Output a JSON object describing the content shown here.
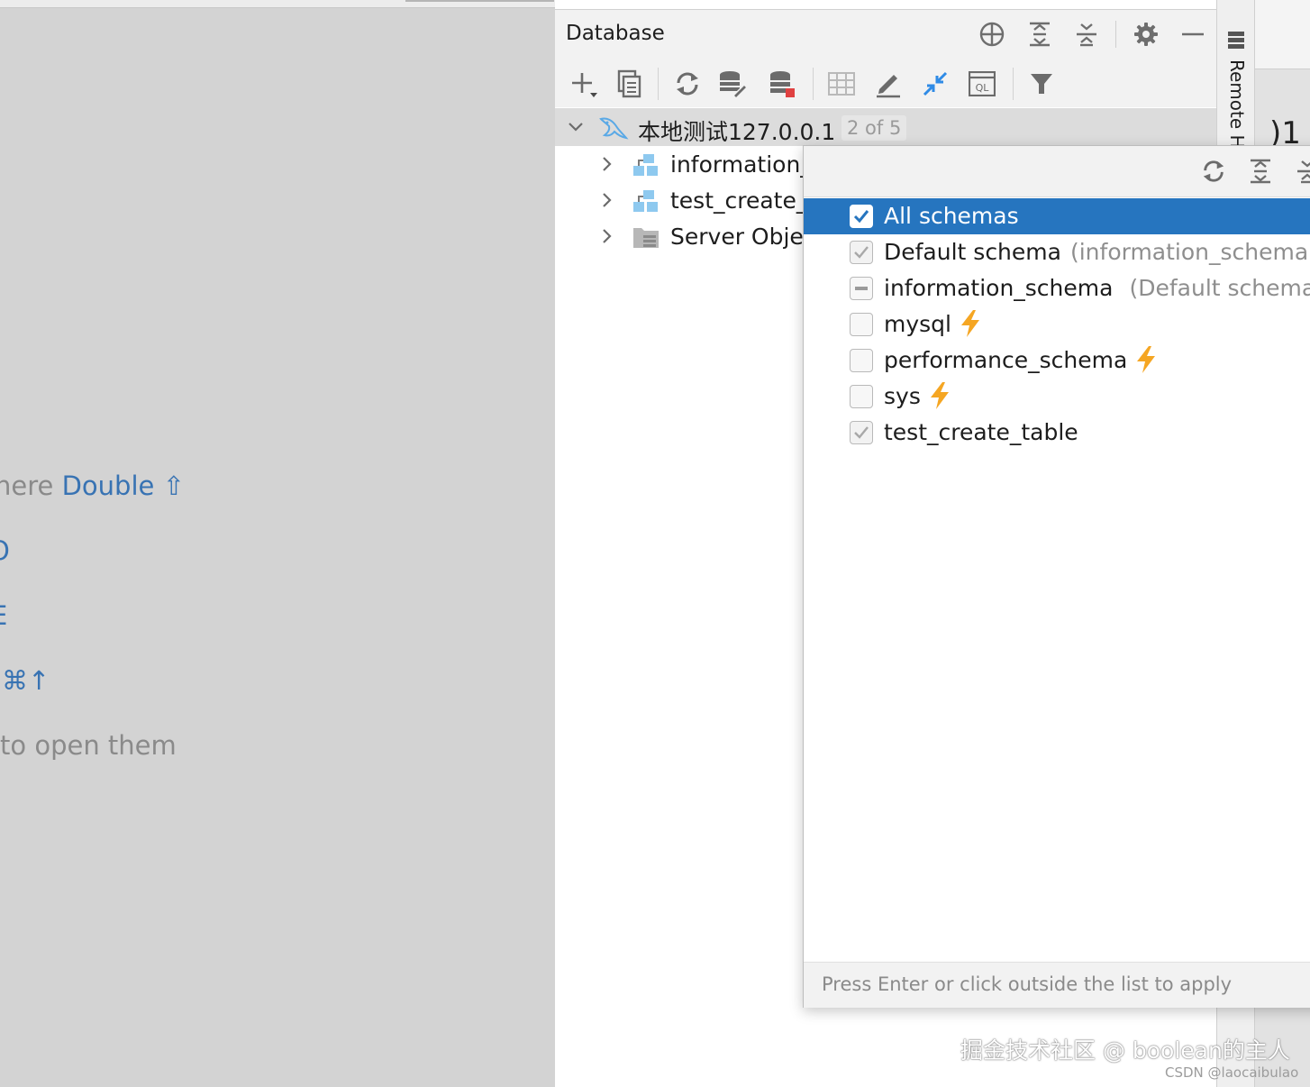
{
  "left_hints": {
    "search_prefix": "here",
    "search_action": "Double",
    "search_key": "⇧",
    "line2": "O",
    "line3": "E",
    "line4": "⌘↑",
    "open_hint": "to open them"
  },
  "database_panel": {
    "title": "Database",
    "header_icons": [
      "crosshair-icon",
      "expand-all-icon",
      "collapse-all-icon",
      "gear-icon",
      "minimize-icon"
    ],
    "toolbar_icons": [
      "add-icon",
      "copy-icon",
      "refresh-icon",
      "schema-tools-icon",
      "datasource-props-icon",
      "table-view-icon",
      "edit-icon",
      "jump-to-icon",
      "query-console-icon",
      "filter-icon"
    ],
    "query_console_label": "QL",
    "tree": {
      "root": {
        "label": "本地测试127.0.0.1",
        "badge": "2 of 5"
      },
      "children": [
        {
          "label": "information_"
        },
        {
          "label": "test_create_"
        },
        {
          "label": "Server Obje"
        }
      ]
    }
  },
  "right_stripe": {
    "label": "Remote H",
    "fragment": ")1"
  },
  "schema_popup": {
    "toolbar_icons": [
      "refresh-icon",
      "expand-all-icon",
      "collapse-all-icon"
    ],
    "items": [
      {
        "name": "All schemas",
        "note": "",
        "state": "checked",
        "lightning": false,
        "selected": true
      },
      {
        "name": "Default schema",
        "note": "(information_schema)",
        "state": "checked-grey",
        "lightning": false,
        "selected": false
      },
      {
        "name": "information_schema",
        "note": "(Default schema)",
        "state": "indeterminate",
        "lightning": false,
        "selected": false
      },
      {
        "name": "mysql",
        "note": "",
        "state": "unchecked",
        "lightning": true,
        "selected": false
      },
      {
        "name": "performance_schema",
        "note": "",
        "state": "unchecked",
        "lightning": true,
        "selected": false
      },
      {
        "name": "sys",
        "note": "",
        "state": "unchecked",
        "lightning": true,
        "selected": false
      },
      {
        "name": "test_create_table",
        "note": "",
        "state": "checked-grey",
        "lightning": false,
        "selected": false
      }
    ],
    "footer": "Press Enter or click outside the list to apply"
  },
  "watermarks": {
    "juejin": "掘金技术社区 @ boolean的主人",
    "csdn": "CSDN @laocaibulao"
  },
  "colors": {
    "selection": "#2675bf",
    "lightning": "#f5a623",
    "link_blue": "#3873b3",
    "mysql_blue": "#5aa9e6"
  }
}
